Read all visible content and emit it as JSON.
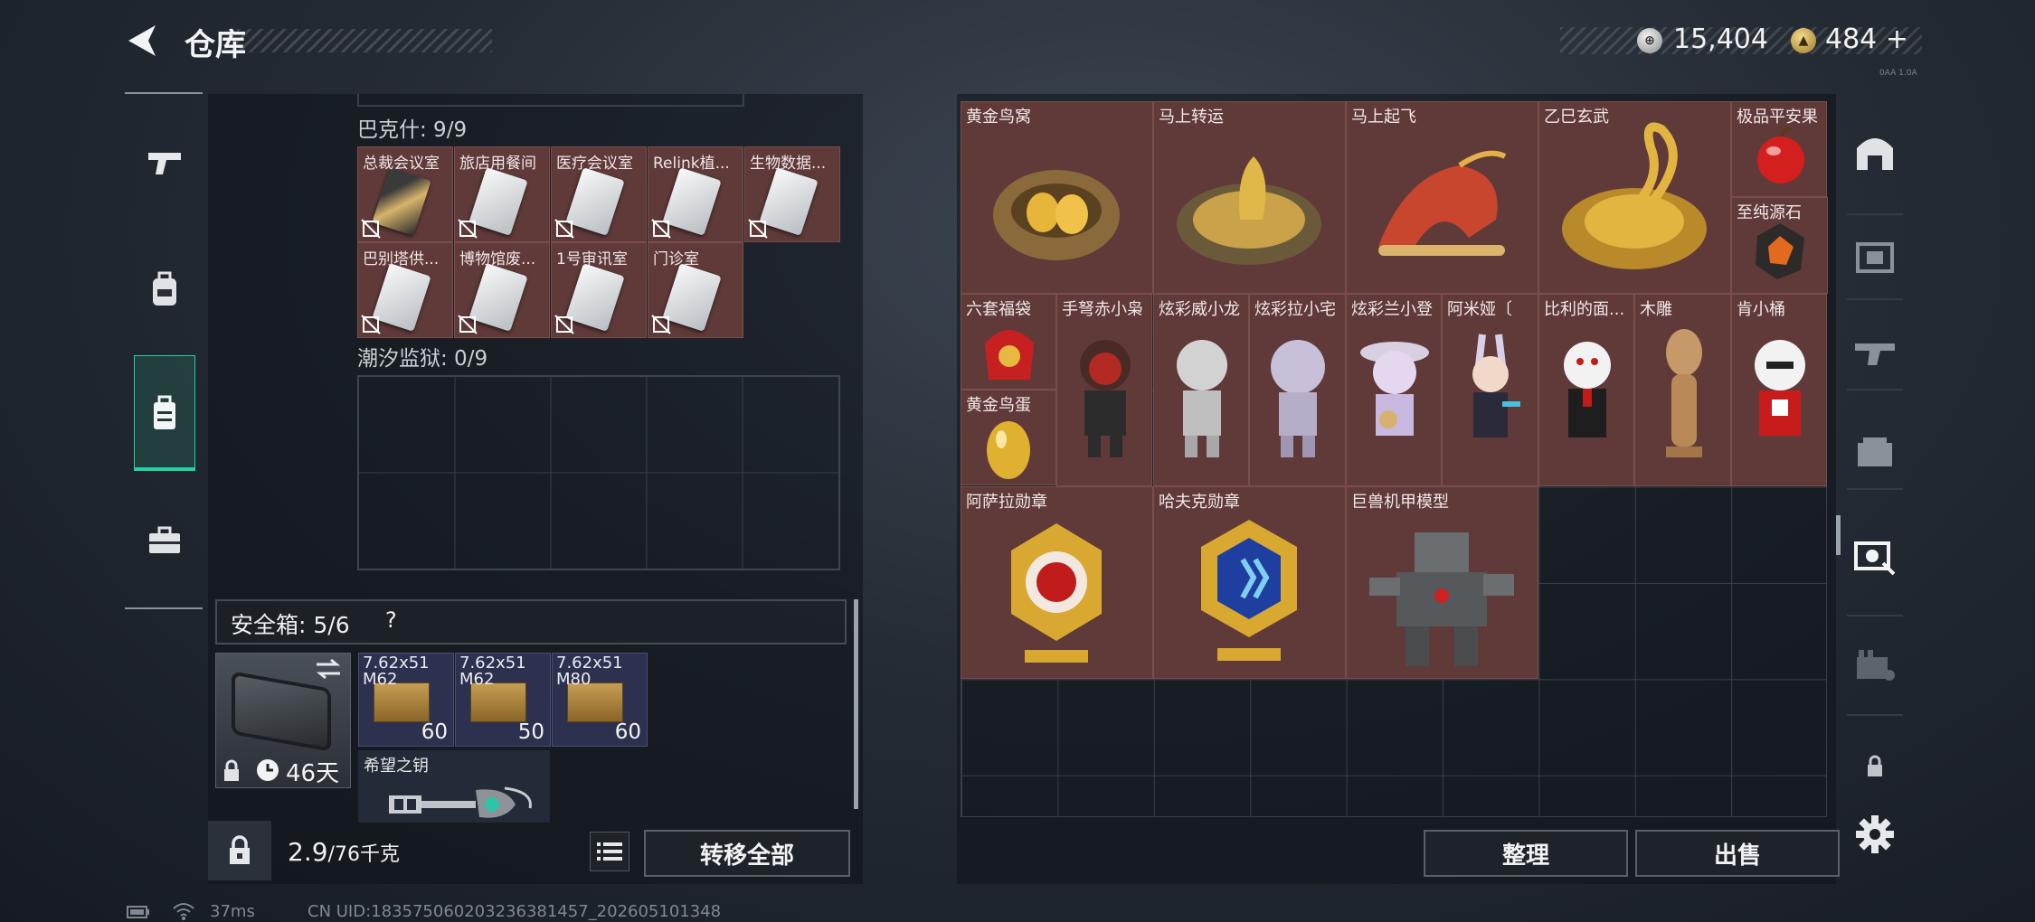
{
  "header": {
    "title": "仓库"
  },
  "currency": {
    "silver": "15,404",
    "gold": "484",
    "gold_plus": "+"
  },
  "version_tag": "0AA 1.0A",
  "left_nav": [
    "weapons-icon",
    "backpack-icon",
    "storage-icon",
    "toolbox-icon"
  ],
  "stash": {
    "section1_label": "巴克什: 9/9",
    "keycards": [
      {
        "name": "总裁会议室",
        "style": "gold"
      },
      {
        "name": "旅店用餐间",
        "style": "silver"
      },
      {
        "name": "医疗会议室",
        "style": "silver"
      },
      {
        "name": "Relink植...",
        "style": "silver"
      },
      {
        "name": "生物数据...",
        "style": "silver"
      },
      {
        "name": "巴别塔供...",
        "style": "silver"
      },
      {
        "name": "博物馆废...",
        "style": "silver"
      },
      {
        "name": "1号审讯室",
        "style": "silver"
      },
      {
        "name": "门诊室",
        "style": "silver"
      }
    ],
    "section2_label": "潮汐监狱: 0/9"
  },
  "safe_box": {
    "label": "安全箱: 5/6",
    "help": "?",
    "case_time": "46天",
    "ammo": [
      {
        "caliber": "7.62x51",
        "type": "M62",
        "count": "60"
      },
      {
        "caliber": "7.62x51",
        "type": "M62",
        "count": "50"
      },
      {
        "caliber": "7.62x51",
        "type": "M80",
        "count": "60"
      }
    ],
    "key_name": "希望之钥"
  },
  "left_footer": {
    "weight": "2.9",
    "weight_max": "/76千克",
    "transfer_label": "转移全部"
  },
  "collectibles": [
    {
      "name": "黄金鸟窝"
    },
    {
      "name": "马上转运"
    },
    {
      "name": "马上起飞"
    },
    {
      "name": "乙巳玄武"
    },
    {
      "name": "极品平安果"
    },
    {
      "name": "至纯源石"
    },
    {
      "name": "六套福袋"
    },
    {
      "name": "黄金鸟蛋"
    },
    {
      "name": "手弩赤小枭"
    },
    {
      "name": "炫彩威小龙"
    },
    {
      "name": "炫彩拉小宅"
    },
    {
      "name": "炫彩兰小登"
    },
    {
      "name": "阿米娅〔"
    },
    {
      "name": "比利的面..."
    },
    {
      "name": "木雕"
    },
    {
      "name": "肯小桶"
    },
    {
      "name": "阿萨拉勋章"
    },
    {
      "name": "哈夫克勋章"
    },
    {
      "name": "巨兽机甲模型"
    }
  ],
  "right_footer": {
    "sort_label": "整理",
    "sell_label": "出售"
  },
  "status": {
    "ping": "37ms",
    "uid": "CN UID:183575060203236381457_202605101348"
  }
}
